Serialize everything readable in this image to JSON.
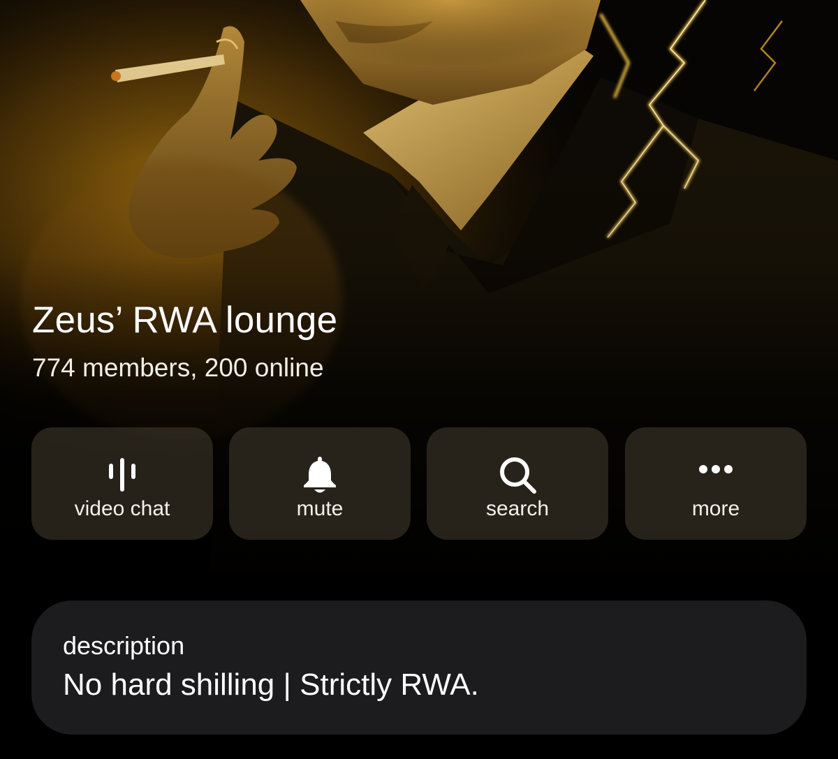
{
  "group": {
    "title": "Zeus’ RWA lounge",
    "subtitle": "774 members, 200 online"
  },
  "actions": [
    {
      "label": "video chat",
      "icon": "voice-chat-icon"
    },
    {
      "label": "mute",
      "icon": "bell-icon"
    },
    {
      "label": "search",
      "icon": "search-icon"
    },
    {
      "label": "more",
      "icon": "more-dots-icon"
    }
  ],
  "description": {
    "label": "description",
    "text": "No hard shilling | Strictly RWA."
  },
  "colors": {
    "background": "#000000",
    "card": "#1c1c1e",
    "glow": "#d9a21b",
    "action_button": "#463e30"
  }
}
